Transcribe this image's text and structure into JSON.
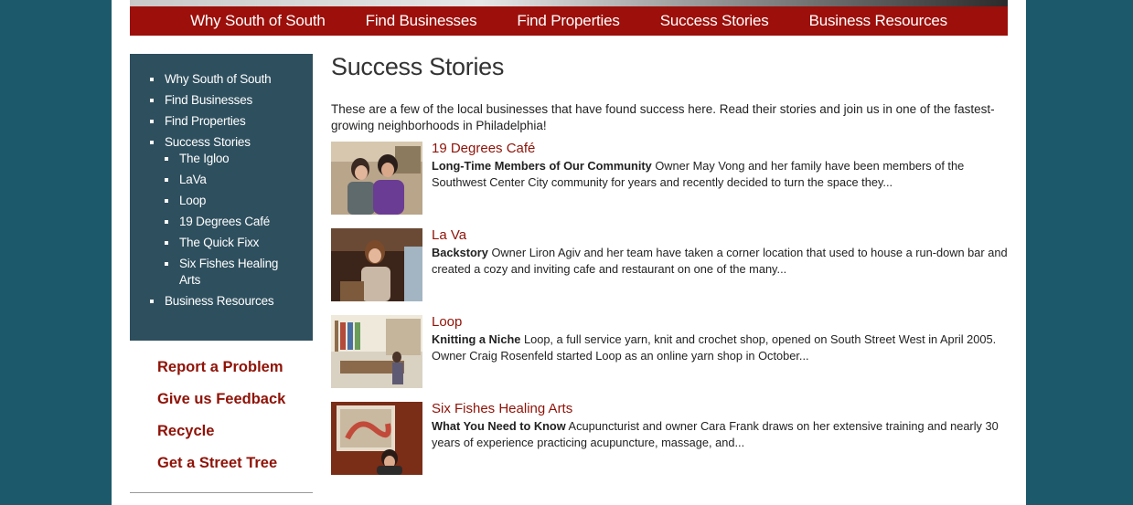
{
  "topnav": [
    "Why South of South",
    "Find Businesses",
    "Find Properties",
    "Success Stories",
    "Business Resources"
  ],
  "sidebar": {
    "items": [
      "Why South of South",
      "Find Businesses",
      "Find Properties",
      "Success Stories"
    ],
    "subitems": [
      "The Igloo",
      "LaVa",
      "Loop",
      "19 Degrees Café",
      "The Quick Fixx",
      "Six Fishes Healing Arts"
    ],
    "last_item": "Business Resources"
  },
  "util_links": [
    "Report a Problem",
    "Give us Feedback",
    "Recycle",
    "Get a Street Tree"
  ],
  "main": {
    "title": "Success Stories",
    "intro": "These are a few of the local businesses that have found success here. Read their stories and join us in one of the fastest-growing neighborhoods in Philadelphia!"
  },
  "stories": [
    {
      "title": "19 Degrees Café",
      "lead": "Long-Time Members of Our Community",
      "text": " Owner May Vong and her family have been members of the Southwest Center City community for years and recently decided to turn the space they..."
    },
    {
      "title": "La Va",
      "lead": "Backstory",
      "text": "  Owner Liron Agiv and her team have taken a corner location that used to house a run-down bar and created a cozy and inviting cafe and restaurant on one of the many..."
    },
    {
      "title": "Loop",
      "lead": "Knitting a Niche",
      "text": "  Loop, a full service yarn, knit and crochet shop, opened on South Street West in April 2005. Owner Craig Rosenfeld started Loop as an online yarn shop in October..."
    },
    {
      "title": "Six Fishes Healing Arts",
      "lead": "What You Need to Know",
      "text": "  Acupuncturist and owner Cara Frank draws on her extensive training and nearly 30 years of experience practicing acupuncture, massage, and..."
    }
  ]
}
